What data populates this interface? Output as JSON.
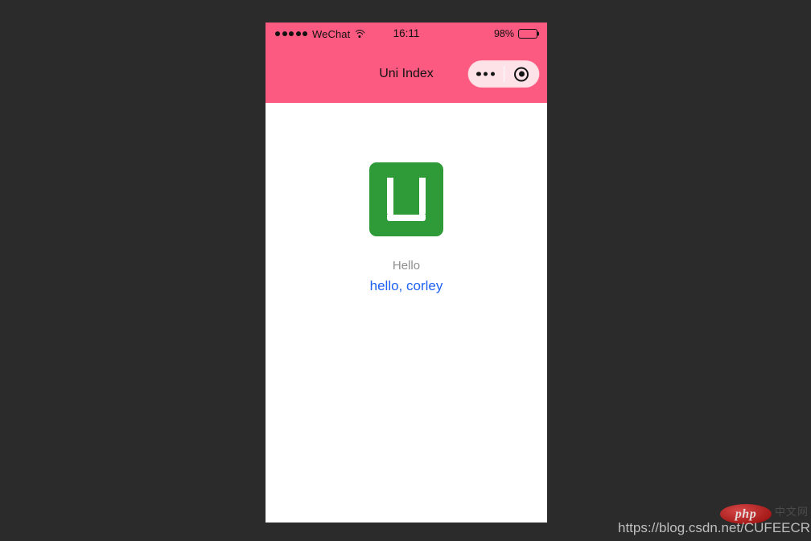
{
  "status_bar": {
    "signal_dots": 5,
    "carrier": "WeChat",
    "wifi_icon": "wifi-icon",
    "time": "16:11",
    "battery_percent": "98%",
    "battery_icon": "battery-full-icon"
  },
  "nav_bar": {
    "title": "Uni Index",
    "capsule": {
      "menu_icon": "more-dots-icon",
      "close_icon": "target-circle-icon"
    }
  },
  "content": {
    "logo": {
      "name": "uni-app-logo",
      "letter": "U",
      "background_color": "#2e9a38",
      "glyph_color": "#ffffff"
    },
    "hello_label": "Hello",
    "hello_value": "hello, corley"
  },
  "watermark": {
    "badge_text": "php",
    "badge_cn_text": "中文网",
    "url": "https://blog.csdn.net/CUFEECR"
  },
  "colors": {
    "page_background": "#2b2b2b",
    "header_pink": "#fc5a80",
    "capsule_pink": "#fde2e8",
    "phone_white": "#ffffff",
    "logo_green": "#2e9a38",
    "hello_label_gray": "#8f8f8f",
    "hello_value_blue": "#1f62f2"
  }
}
